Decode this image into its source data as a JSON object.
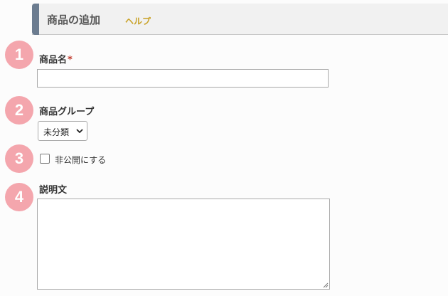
{
  "header": {
    "title": "商品の追加",
    "help_label": "ヘルプ",
    "accent_color": "#6c7c90",
    "help_color": "#c9a227"
  },
  "step_color": "#f4a6ad",
  "steps": [
    {
      "number": "1",
      "label": "商品名",
      "required_mark": "*"
    },
    {
      "number": "2",
      "label": "商品グループ"
    },
    {
      "number": "3",
      "label": "非公開にする"
    },
    {
      "number": "4",
      "label": "説明文"
    }
  ],
  "product_name": {
    "value": ""
  },
  "product_group": {
    "selected": "未分類",
    "icon": "chevron-down-icon"
  },
  "private_checkbox": {
    "checked": false
  },
  "description": {
    "value": "",
    "resize_icon": "resize-handle-icon"
  }
}
